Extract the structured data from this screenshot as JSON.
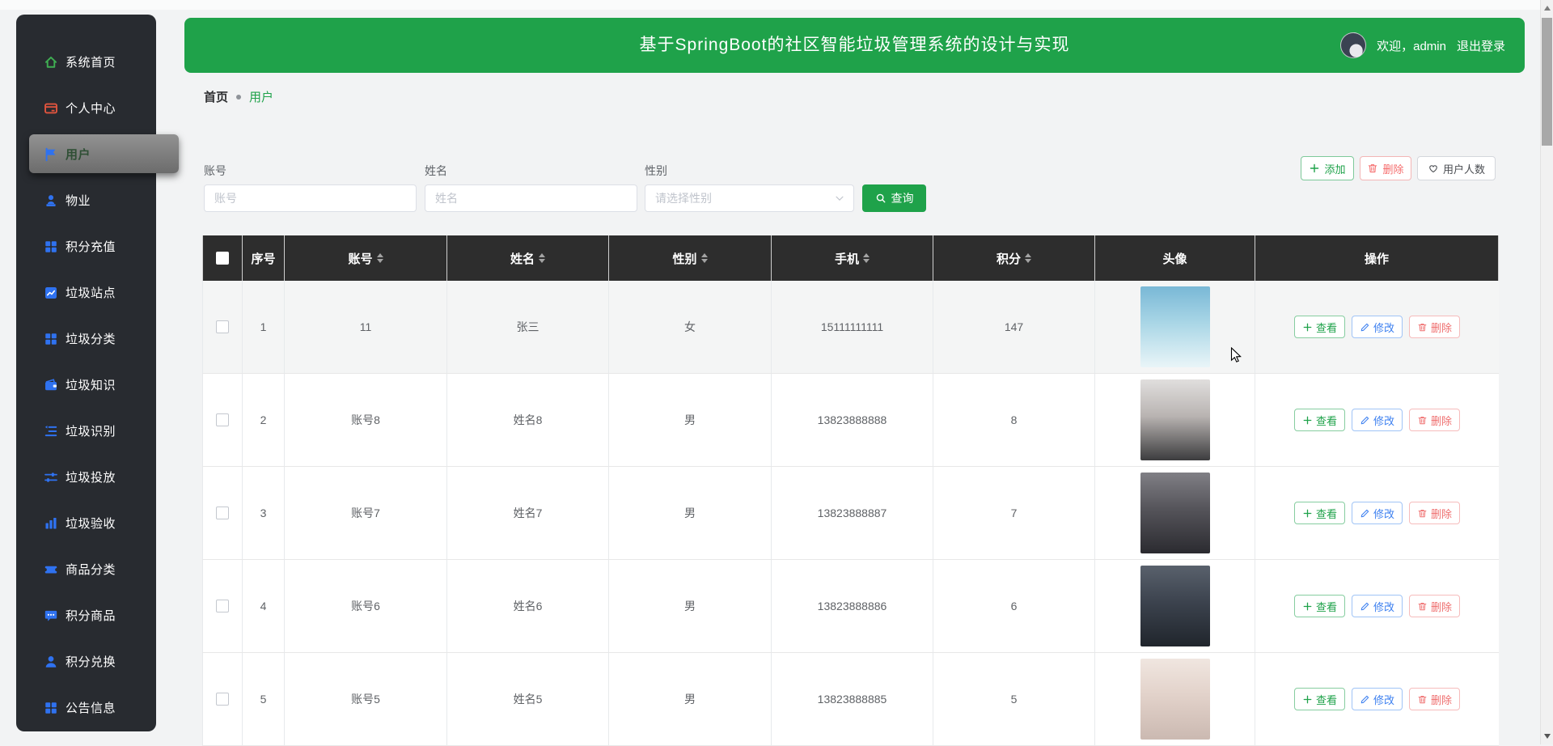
{
  "app": {
    "title": "基于SpringBoot的社区智能垃圾管理系统的设计与实现",
    "welcome": "欢迎，admin",
    "logout": "退出登录"
  },
  "breadcrumb": {
    "home": "首页",
    "current": "用户"
  },
  "sidebar": {
    "items": [
      {
        "id": "home",
        "label": "系统首页",
        "icon": "home-icon",
        "icon_color": "#3fae52",
        "active": false
      },
      {
        "id": "profile",
        "label": "个人中心",
        "icon": "card-icon",
        "icon_color": "#e0543e",
        "active": false
      },
      {
        "id": "users",
        "label": "用户",
        "icon": "flag-icon",
        "icon_color": "#2f72f0",
        "active": true
      },
      {
        "id": "property",
        "label": "物业",
        "icon": "stamp-icon",
        "icon_color": "#2f72f0",
        "active": false
      },
      {
        "id": "recharge",
        "label": "积分充值",
        "icon": "grid-icon",
        "icon_color": "#2f72f0",
        "active": false
      },
      {
        "id": "station",
        "label": "垃圾站点",
        "icon": "chart-icon",
        "icon_color": "#2f72f0",
        "active": false
      },
      {
        "id": "category",
        "label": "垃圾分类",
        "icon": "grid-icon",
        "icon_color": "#2f72f0",
        "active": false
      },
      {
        "id": "knowledge",
        "label": "垃圾知识",
        "icon": "wallet-icon",
        "icon_color": "#2f72f0",
        "active": false
      },
      {
        "id": "recognition",
        "label": "垃圾识别",
        "icon": "list-icon",
        "icon_color": "#2f72f0",
        "active": false
      },
      {
        "id": "dropoff",
        "label": "垃圾投放",
        "icon": "sliders-icon",
        "icon_color": "#2f72f0",
        "active": false
      },
      {
        "id": "acceptance",
        "label": "垃圾验收",
        "icon": "barchart-icon",
        "icon_color": "#2f72f0",
        "active": false
      },
      {
        "id": "goods-cat",
        "label": "商品分类",
        "icon": "ticket-icon",
        "icon_color": "#2f72f0",
        "active": false
      },
      {
        "id": "points-goods",
        "label": "积分商品",
        "icon": "chat-icon",
        "icon_color": "#2f72f0",
        "active": false
      },
      {
        "id": "points-exch",
        "label": "积分兑换",
        "icon": "user-icon",
        "icon_color": "#2f72f0",
        "active": false
      },
      {
        "id": "notice",
        "label": "公告信息",
        "icon": "grid-icon",
        "icon_color": "#2f72f0",
        "active": false
      }
    ]
  },
  "filters": {
    "account": {
      "label": "账号",
      "placeholder": "账号",
      "value": ""
    },
    "name": {
      "label": "姓名",
      "placeholder": "姓名",
      "value": ""
    },
    "gender": {
      "label": "性别",
      "placeholder": "请选择性别"
    },
    "search_label": "查询"
  },
  "toolbar": {
    "add_label": "添加",
    "delete_label": "删除",
    "count_label": "用户人数"
  },
  "table": {
    "columns": [
      {
        "label": "",
        "type": "checkbox",
        "sortable": false
      },
      {
        "label": "序号",
        "type": "text",
        "sortable": false
      },
      {
        "label": "账号",
        "type": "text",
        "sortable": true
      },
      {
        "label": "姓名",
        "type": "text",
        "sortable": true
      },
      {
        "label": "性别",
        "type": "text",
        "sortable": true
      },
      {
        "label": "手机",
        "type": "text",
        "sortable": true
      },
      {
        "label": "积分",
        "type": "text",
        "sortable": true
      },
      {
        "label": "头像",
        "type": "image",
        "sortable": false
      },
      {
        "label": "操作",
        "type": "actions",
        "sortable": false
      }
    ],
    "rows": [
      {
        "seq": "1",
        "account": "11",
        "name": "张三",
        "gender": "女",
        "phone": "15111111111",
        "points": "147",
        "avatar_from": "#79b8d6",
        "avatar_mid": "#a9d6e6",
        "avatar_to": "#e9f5f8"
      },
      {
        "seq": "2",
        "account": "账号8",
        "name": "姓名8",
        "gender": "男",
        "phone": "13823888888",
        "points": "8",
        "avatar_from": "#e0dedd",
        "avatar_mid": "#b9b4b2",
        "avatar_to": "#3c3c3e"
      },
      {
        "seq": "3",
        "account": "账号7",
        "name": "姓名7",
        "gender": "男",
        "phone": "13823888887",
        "points": "7",
        "avatar_from": "#807f85",
        "avatar_mid": "#55545a",
        "avatar_to": "#2b2b30"
      },
      {
        "seq": "4",
        "account": "账号6",
        "name": "姓名6",
        "gender": "男",
        "phone": "13823888886",
        "points": "6",
        "avatar_from": "#59616c",
        "avatar_mid": "#3c434e",
        "avatar_to": "#20252c"
      },
      {
        "seq": "5",
        "account": "账号5",
        "name": "姓名5",
        "gender": "男",
        "phone": "13823888885",
        "points": "5",
        "avatar_from": "#f0e6e0",
        "avatar_mid": "#e2d2ca",
        "avatar_to": "#cbb9b1"
      }
    ],
    "row_actions": [
      {
        "id": "view",
        "label": "查看",
        "icon": "plus-icon",
        "style": "green"
      },
      {
        "id": "edit",
        "label": "修改",
        "icon": "edit-icon",
        "style": "blue"
      },
      {
        "id": "delete",
        "label": "删除",
        "icon": "trash-icon",
        "style": "red"
      }
    ],
    "hovered_seq": "1"
  },
  "colors": {
    "accent_green": "#1fa24a",
    "accent_blue": "#2f72f0",
    "danger_red": "#f56c6c",
    "sidebar_bg": "#282b30",
    "table_header_bg": "#2d2d2d"
  }
}
